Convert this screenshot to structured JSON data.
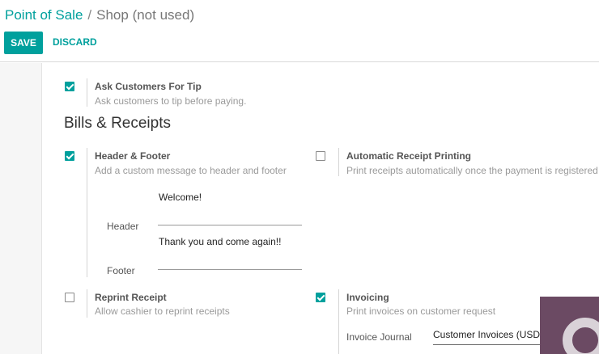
{
  "breadcrumb": {
    "parent": "Point of Sale",
    "separator": "/",
    "current": "Shop (not used)"
  },
  "buttons": {
    "save": "SAVE",
    "discard": "DISCARD"
  },
  "settings": {
    "tip": {
      "checked": true,
      "title": "Ask Customers For Tip",
      "description": "Ask customers to tip before paying."
    },
    "section_title": "Bills & Receipts",
    "header_footer": {
      "checked": true,
      "title": "Header & Footer",
      "description": "Add a custom message to header and footer",
      "header_label": "Header",
      "header_value": "Welcome!",
      "footer_label": "Footer",
      "footer_value": "Thank you and come again!!"
    },
    "auto_print": {
      "checked": false,
      "title": "Automatic Receipt Printing",
      "description": "Print receipts automatically once the payment is registered"
    },
    "reprint": {
      "checked": false,
      "title": "Reprint Receipt",
      "description": "Allow cashier to reprint receipts"
    },
    "invoicing": {
      "checked": true,
      "title": "Invoicing",
      "description": "Print invoices on customer request",
      "journal_label": "Invoice Journal",
      "journal_value": "Customer Invoices (USD)"
    }
  },
  "colors": {
    "accent": "#00a09d",
    "overlay": "#6b4a63"
  }
}
